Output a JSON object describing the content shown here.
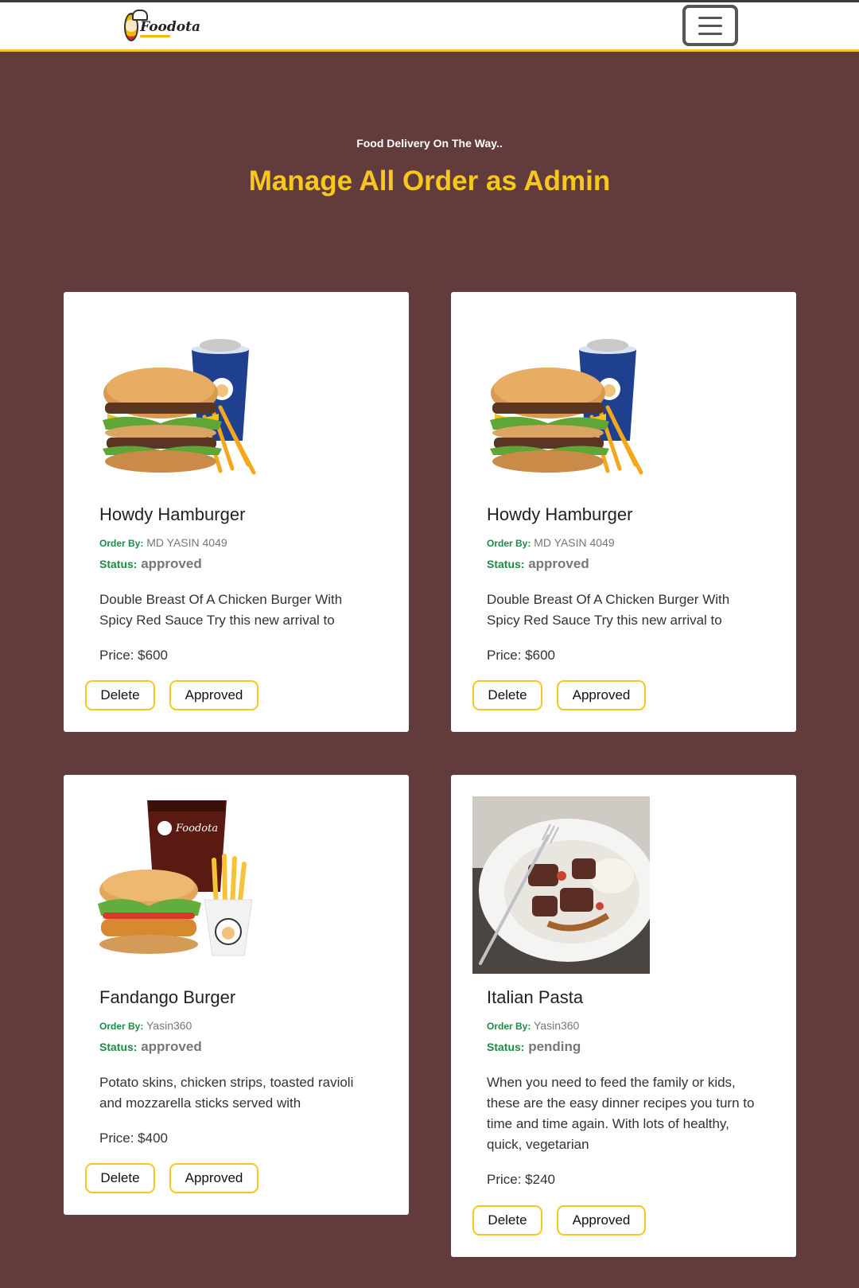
{
  "nav": {
    "logo_text": "Foodota"
  },
  "hero": {
    "subtitle": "Food Delivery On The Way..",
    "title": "Manage All Order as Admin"
  },
  "labels": {
    "order_by": "Order By:",
    "status": "Status:",
    "delete": "Delete",
    "approved": "Approved"
  },
  "orders": [
    {
      "name": "Howdy Hamburger",
      "order_by": "MD YASIN 4049",
      "status": "approved",
      "description": "Double Breast Of A Chicken Burger With Spicy Red Sauce Try this new arrival to",
      "price": "Price: $600",
      "image": "burger-combo-icon"
    },
    {
      "name": "Howdy Hamburger",
      "order_by": "MD YASIN 4049",
      "status": "approved",
      "description": "Double Breast Of A Chicken Burger With Spicy Red Sauce Try this new arrival to",
      "price": "Price: $600",
      "image": "burger-combo-icon"
    },
    {
      "name": "Fandango Burger",
      "order_by": "Yasin360",
      "status": "approved",
      "description": "Potato skins, chicken strips, toasted ravioli and mozzarella sticks served with",
      "price": "Price: $400",
      "image": "chicken-burger-combo-icon"
    },
    {
      "name": "Italian Pasta",
      "order_by": "Yasin360",
      "status": "pending",
      "description": "When you need to feed the family or kids, these are the easy dinner recipes you turn to time and time again. With lots of healthy, quick, vegetarian",
      "price": "Price: $240",
      "image": "pot-roast-plate-icon"
    }
  ],
  "colors": {
    "background": "#623c3c",
    "accent": "#f7c71d",
    "label_green": "#1e8a45"
  }
}
